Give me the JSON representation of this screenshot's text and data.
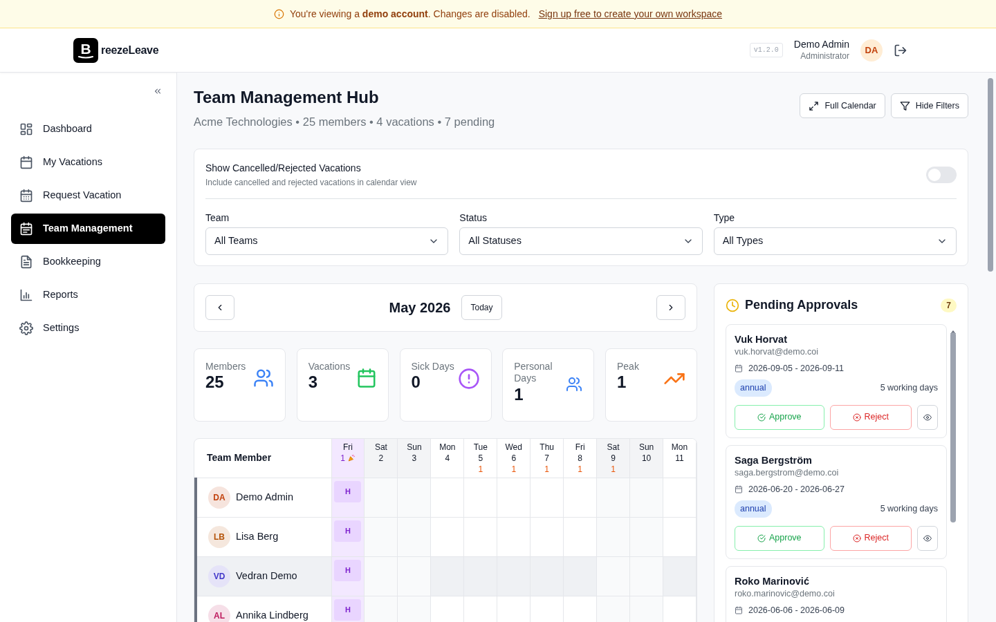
{
  "banner": {
    "text": "You're viewing a **demo account**. Changes are disabled.",
    "link": "Sign up free to create your own workspace"
  },
  "header": {
    "logo_mark": "B",
    "logo_text": "reezeLeave",
    "version": "v1.2.0",
    "user_name": "Demo Admin",
    "user_role": "Administrator",
    "user_initials": "DA"
  },
  "sidebar": {
    "items": [
      {
        "label": "Dashboard",
        "selected": false
      },
      {
        "label": "My Vacations",
        "selected": false
      },
      {
        "label": "Request Vacation",
        "selected": false
      },
      {
        "label": "Team Management",
        "selected": true
      },
      {
        "label": "Bookkeeping",
        "selected": false
      },
      {
        "label": "Reports",
        "selected": false
      },
      {
        "label": "Settings",
        "selected": false
      }
    ]
  },
  "page": {
    "title": "Team Management Hub",
    "subtitle": "Acme Technologies • 25 members • 4 vacations • 7 pending",
    "actions": [
      "Full Calendar",
      "Hide Filters"
    ]
  },
  "filters": {
    "toggle": {
      "label": "Show Cancelled/Rejected Vacations",
      "description": "Include cancelled and rejected vacations in calendar view",
      "on": false
    },
    "selects": [
      {
        "label": "Team",
        "value": "All Teams"
      },
      {
        "label": "Status",
        "value": "All Statuses"
      },
      {
        "label": "Type",
        "value": "All Types"
      }
    ]
  },
  "calendar_nav": {
    "month": "May 2026",
    "today": "Today"
  },
  "stats": [
    {
      "label": "Members",
      "value": "25",
      "kind": "users"
    },
    {
      "label": "Vacations",
      "value": "3",
      "kind": "calendar"
    },
    {
      "label": "Sick Days",
      "value": "0",
      "kind": "alert"
    },
    {
      "label": "Personal Days",
      "value": "1",
      "kind": "users-small"
    },
    {
      "label": "Peak",
      "value": "1",
      "kind": "trend"
    }
  ],
  "table": {
    "member_header": "Team Member",
    "days": [
      {
        "weekday": "Fri",
        "date": "1",
        "holiday": true,
        "weekend": false
      },
      {
        "weekday": "Sat",
        "date": "2",
        "holiday": false,
        "weekend": true
      },
      {
        "weekday": "Sun",
        "date": "3",
        "holiday": false,
        "weekend": true
      },
      {
        "weekday": "Mon",
        "date": "4",
        "holiday": false,
        "weekend": false
      },
      {
        "weekday": "Tue",
        "date": "5",
        "count": "1",
        "holiday": false,
        "weekend": false
      },
      {
        "weekday": "Wed",
        "date": "6",
        "count": "1",
        "holiday": false,
        "weekend": false
      },
      {
        "weekday": "Thu",
        "date": "7",
        "count": "1",
        "holiday": false,
        "weekend": false
      },
      {
        "weekday": "Fri",
        "date": "8",
        "count": "1",
        "holiday": false,
        "weekend": false
      },
      {
        "weekday": "Sat",
        "date": "9",
        "count": "1",
        "holiday": false,
        "weekend": true
      },
      {
        "weekday": "Sun",
        "date": "10",
        "holiday": false,
        "weekend": true
      },
      {
        "weekday": "Mon",
        "date": "11",
        "holiday": false,
        "weekend": false
      }
    ],
    "rows": [
      {
        "initials": "DA",
        "name": "Demo Admin",
        "color": "#c2410c",
        "holiday_label": "H",
        "highlighted": false
      },
      {
        "initials": "LB",
        "name": "Lisa Berg",
        "color": "#b45309",
        "holiday_label": "H",
        "highlighted": false
      },
      {
        "initials": "VD",
        "name": "Vedran Demo",
        "color": "#4338ca",
        "holiday_label": "H",
        "highlighted": true
      },
      {
        "initials": "AL",
        "name": "Annika Lindberg",
        "color": "#be185d",
        "holiday_label": "H",
        "highlighted": false
      }
    ]
  },
  "pending": {
    "title": "Pending Approvals",
    "count": "7",
    "requests": [
      {
        "name": "Vuk Horvat",
        "email": "vuk.horvat@demo.coi",
        "dates": "2026-09-05 - 2026-09-11",
        "type": "annual",
        "days": "5 working days",
        "approve": "Approve",
        "reject": "Reject"
      },
      {
        "name": "Saga Bergström",
        "email": "saga.bergstrom@demo.coi",
        "dates": "2026-06-20 - 2026-06-27",
        "type": "annual",
        "days": "5 working days",
        "approve": "Approve",
        "reject": "Reject"
      },
      {
        "name": "Roko Marinović",
        "email": "roko.marinovic@demo.coi",
        "dates": "2026-06-06 - 2026-06-09"
      }
    ]
  }
}
